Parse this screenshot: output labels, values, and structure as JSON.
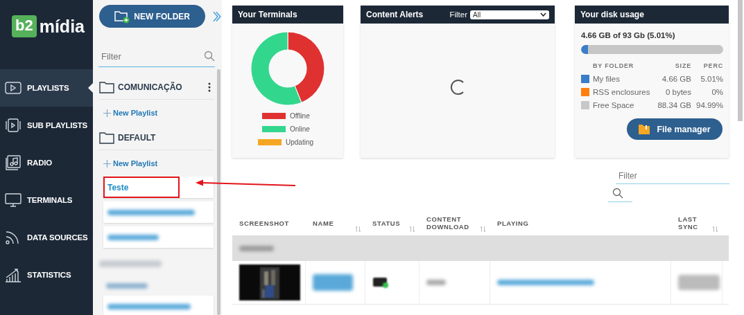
{
  "sidebar": {
    "logo": {
      "badge": "b2",
      "text": "mídia"
    },
    "items": [
      {
        "label": "PLAYLISTS",
        "kind": "playlist",
        "selected": true
      },
      {
        "label": "SUB PLAYLISTS",
        "kind": "subplaylist",
        "selected": false
      },
      {
        "label": "RADIO",
        "kind": "radio",
        "selected": false
      },
      {
        "label": "TERMINALS",
        "kind": "monitor",
        "selected": false
      },
      {
        "label": "DATA SOURCES",
        "kind": "feed",
        "selected": false
      },
      {
        "label": "STATISTICS",
        "kind": "chart",
        "selected": false
      }
    ]
  },
  "panel": {
    "new_folder_button": "NEW FOLDER",
    "filter": {
      "placeholder": "Filter"
    },
    "folders": [
      {
        "name": "COMUNICAÇÃO",
        "menu": true,
        "new_playlist": "New Playlist"
      },
      {
        "name": "DEFAULT",
        "menu": false,
        "new_playlist": "New Playlist",
        "playlists": [
          {
            "name": "Teste",
            "highlighted": true
          }
        ]
      }
    ]
  },
  "terminals": {
    "title": "Your Terminals",
    "legend": [
      {
        "label": "Offline",
        "color": "#e03131"
      },
      {
        "label": "Online",
        "color": "#33d68d"
      },
      {
        "label": "Updating",
        "color": "#f5a623"
      }
    ]
  },
  "alerts": {
    "title": "Content Alerts",
    "filter_label": "Filter",
    "filter_value": "All",
    "loading": true
  },
  "disk": {
    "title": "Your disk usage",
    "summary": "4.66 GB of 93 Gb (5.01%)",
    "level": 0.0501,
    "columns": [
      "BY FOLDER",
      "SIZE",
      "PERC"
    ],
    "rows": [
      {
        "name": "My files",
        "size": "4.66 GB",
        "perc": "5.01%",
        "color": "#3a7dc9"
      },
      {
        "name": "RSS enclosures",
        "size": "0 bytes",
        "perc": "0%",
        "color": "#ff7f0e"
      },
      {
        "name": "Free Space",
        "size": "88.34 GB",
        "perc": "94.99%",
        "color": "#c8c8c8"
      }
    ],
    "button": "File manager"
  },
  "table": {
    "filter": {
      "placeholder": "Filter"
    },
    "columns": [
      {
        "label": "SCREENSHOT",
        "sortable": false
      },
      {
        "label": "NAME",
        "sortable": true
      },
      {
        "label": "STATUS",
        "sortable": true
      },
      {
        "label": "CONTENT DOWNLOAD",
        "sortable": true
      },
      {
        "label": "PLAYING",
        "sortable": false
      },
      {
        "label": "LAST SYNC",
        "sortable": true
      }
    ]
  }
}
